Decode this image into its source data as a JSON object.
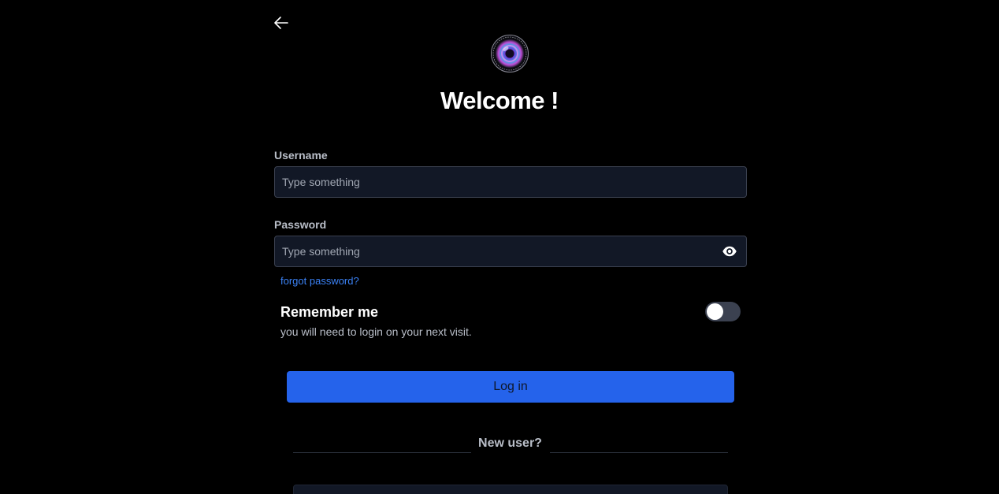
{
  "header": {
    "back_icon": "arrow-left-icon",
    "logo_icon": "camera-lens-icon",
    "title": "Welcome !"
  },
  "form": {
    "username": {
      "label": "Username",
      "value": "",
      "placeholder": "Type something"
    },
    "password": {
      "label": "Password",
      "value": "",
      "placeholder": "Type something",
      "toggle_icon": "eye-icon"
    },
    "forgot_password": "forgot password?",
    "remember": {
      "title": "Remember me",
      "subtitle": "you will need to login on your next visit.",
      "enabled": false
    },
    "login_label": "Log in"
  },
  "footer": {
    "new_user_label": "New user?"
  },
  "colors": {
    "background": "#000000",
    "input_bg": "#121826",
    "accent": "#2563eb",
    "link": "#3b82f6",
    "muted_text": "#b9bec8"
  }
}
